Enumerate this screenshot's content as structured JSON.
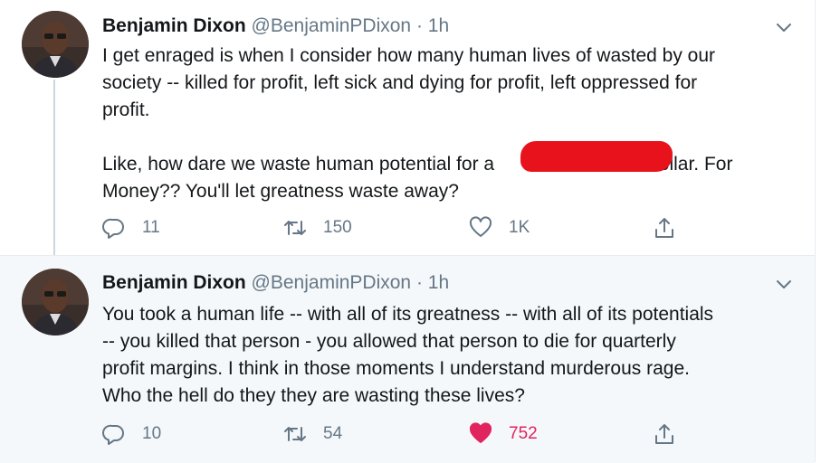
{
  "colors": {
    "like_active": "#e0245e",
    "redaction": "#e8121c",
    "secondary_text": "#657786"
  },
  "tweets": [
    {
      "name": "Benjamin Dixon",
      "handle": "@BenjaminPDixon",
      "dot": "·",
      "time": "1h",
      "text_line1": "I get enraged is when I consider how many human lives of wasted by our\nsociety -- killed for profit, left sick and dying for profit, left oppressed for\nprofit.\n\nLike, how dare we waste human potential for a",
      "text_line2": "dollar. For\nMoney?? You'll let greatness waste away?",
      "replies": "11",
      "retweets": "150",
      "likes": "1K",
      "liked": false
    },
    {
      "name": "Benjamin Dixon",
      "handle": "@BenjaminPDixon",
      "dot": "·",
      "time": "1h",
      "text": "You took a human life -- with all of its greatness -- with all of its potentials\n-- you killed that person - you allowed that person to die for quarterly\nprofit margins. I think in those moments I understand murderous rage.\nWho the hell do they they are wasting these lives?",
      "replies": "10",
      "retweets": "54",
      "likes": "752",
      "liked": true
    }
  ],
  "icons": {
    "reply": "reply-icon",
    "retweet": "retweet-icon",
    "like": "heart-icon",
    "share": "share-icon",
    "menu": "chevron-down-icon"
  }
}
